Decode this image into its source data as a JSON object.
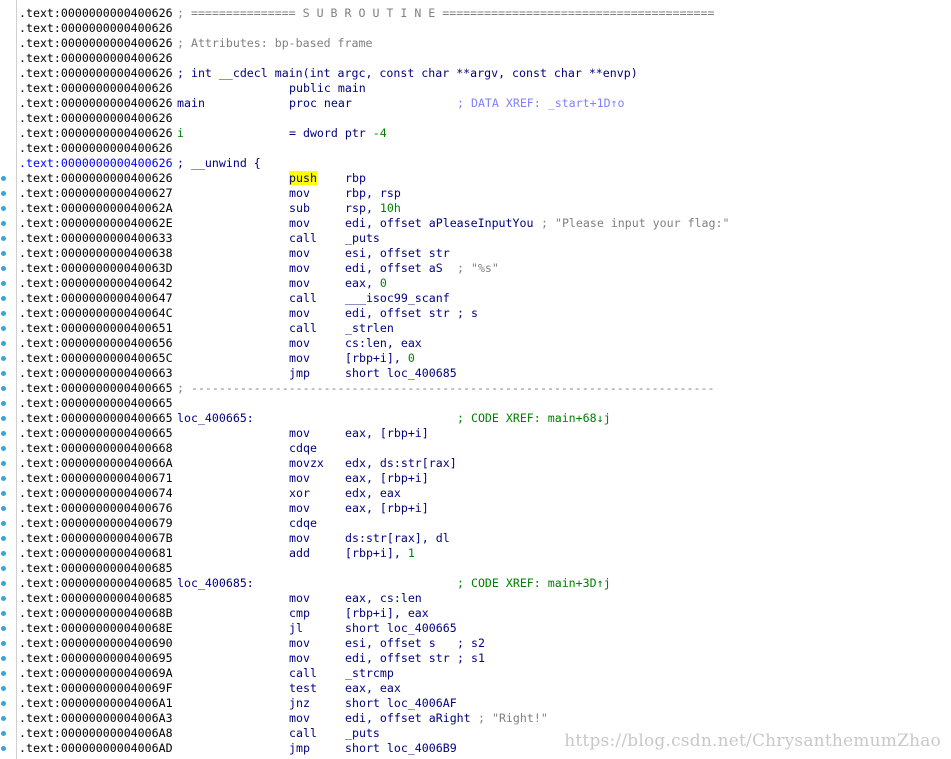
{
  "rows": [
    {
      "addr": ".text:0000000000400626",
      "c1": "; =============== S U B R O U T I N E =======================================",
      "c1cls": "cmt"
    },
    {
      "addr": ".text:0000000000400626"
    },
    {
      "addr": ".text:0000000000400626",
      "c1": "; Attributes: bp-based frame",
      "c1cls": "cmt"
    },
    {
      "addr": ".text:0000000000400626"
    },
    {
      "addr": ".text:0000000000400626",
      "c1": "; int __cdecl main(int argc, const char **argv, const char **envp)",
      "c1cls": "proto"
    },
    {
      "addr": ".text:0000000000400626",
      "c2": "public main"
    },
    {
      "addr": ".text:0000000000400626",
      "c1": "main",
      "c2": "proc near",
      "tail": "; DATA XREF: _start+1D↑o",
      "tailcls": "xrefd",
      "tailpos": 457
    },
    {
      "addr": ".text:0000000000400626"
    },
    {
      "addr": ".text:0000000000400626",
      "c1": "i",
      "c1cls": "var",
      "c2": "= dword ptr -4",
      "c2num": "-4"
    },
    {
      "addr": ".text:0000000000400626"
    },
    {
      "addr": ".text:0000000000400626",
      "c1": "; __unwind {",
      "c1cls": "proto",
      "cur": true
    },
    {
      "addr": ".text:0000000000400626",
      "dot": true,
      "c2": "push",
      "c2hl": true,
      "c3": "rbp"
    },
    {
      "addr": ".text:0000000000400627",
      "dot": true,
      "c2": "mov",
      "c3": "rbp, rsp"
    },
    {
      "addr": ".text:000000000040062A",
      "dot": true,
      "c2": "sub",
      "c3": "rsp, 10h",
      "c3num": "10h"
    },
    {
      "addr": ".text:000000000040062E",
      "dot": true,
      "c2": "mov",
      "c3": "edi, offset aPleaseInputYou",
      "tail": "; \"Please input your flag:\"",
      "tailcls": "cmt",
      "tailpos": 541
    },
    {
      "addr": ".text:0000000000400633",
      "dot": true,
      "c2": "call",
      "c3": "_puts"
    },
    {
      "addr": ".text:0000000000400638",
      "dot": true,
      "c2": "mov",
      "c3": "esi, offset str"
    },
    {
      "addr": ".text:000000000040063D",
      "dot": true,
      "c2": "mov",
      "c3": "edi, offset aS",
      "tail": "; \"%s\"",
      "tailcls": "cmt",
      "tailpos": 457
    },
    {
      "addr": ".text:0000000000400642",
      "dot": true,
      "c2": "mov",
      "c3": "eax, 0",
      "c3num": "0"
    },
    {
      "addr": ".text:0000000000400647",
      "dot": true,
      "c2": "call",
      "c3": "___isoc99_scanf"
    },
    {
      "addr": ".text:000000000040064C",
      "dot": true,
      "c2": "mov",
      "c3": "edi, offset str",
      "tail": "; s",
      "tailcls": "ins",
      "tailpos": 457
    },
    {
      "addr": ".text:0000000000400651",
      "dot": true,
      "c2": "call",
      "c3": "_strlen"
    },
    {
      "addr": ".text:0000000000400656",
      "dot": true,
      "c2": "mov",
      "c3": "cs:len, eax"
    },
    {
      "addr": ".text:000000000040065C",
      "dot": true,
      "c2": "mov",
      "c3": "[rbp+i], 0",
      "c3num": "0"
    },
    {
      "addr": ".text:0000000000400663",
      "dot": true,
      "c2": "jmp",
      "c3": "short loc_400685"
    },
    {
      "addr": ".text:0000000000400665",
      "dot": true,
      "c1": "; ---------------------------------------------------------------------------",
      "c1cls": "sep"
    },
    {
      "addr": ".text:0000000000400665",
      "dot": true
    },
    {
      "addr": ".text:0000000000400665",
      "dot": true,
      "c1": "loc_400665:",
      "tail": "; CODE XREF: main+68↓j",
      "tailcls": "xref",
      "tailpos": 457
    },
    {
      "addr": ".text:0000000000400665",
      "dot": true,
      "c2": "mov",
      "c3": "eax, [rbp+i]"
    },
    {
      "addr": ".text:0000000000400668",
      "dot": true,
      "c2": "cdqe"
    },
    {
      "addr": ".text:000000000040066A",
      "dot": true,
      "c2": "movzx",
      "c3": "edx, ds:str[rax]"
    },
    {
      "addr": ".text:0000000000400671",
      "dot": true,
      "c2": "mov",
      "c3": "eax, [rbp+i]"
    },
    {
      "addr": ".text:0000000000400674",
      "dot": true,
      "c2": "xor",
      "c3": "edx, eax"
    },
    {
      "addr": ".text:0000000000400676",
      "dot": true,
      "c2": "mov",
      "c3": "eax, [rbp+i]"
    },
    {
      "addr": ".text:0000000000400679",
      "dot": true,
      "c2": "cdqe"
    },
    {
      "addr": ".text:000000000040067B",
      "dot": true,
      "c2": "mov",
      "c3": "ds:str[rax], dl"
    },
    {
      "addr": ".text:0000000000400681",
      "dot": true,
      "c2": "add",
      "c3": "[rbp+i], 1",
      "c3num": "1"
    },
    {
      "addr": ".text:0000000000400685",
      "dot": true
    },
    {
      "addr": ".text:0000000000400685",
      "dot": true,
      "c1": "loc_400685:",
      "tail": "; CODE XREF: main+3D↑j",
      "tailcls": "xref",
      "tailpos": 457
    },
    {
      "addr": ".text:0000000000400685",
      "dot": true,
      "c2": "mov",
      "c3": "eax, cs:len"
    },
    {
      "addr": ".text:000000000040068B",
      "dot": true,
      "c2": "cmp",
      "c3": "[rbp+i], eax"
    },
    {
      "addr": ".text:000000000040068E",
      "dot": true,
      "c2": "jl",
      "c3": "short loc_400665"
    },
    {
      "addr": ".text:0000000000400690",
      "dot": true,
      "c2": "mov",
      "c3": "esi, offset s",
      "tail": "; s2",
      "tailcls": "ins",
      "tailpos": 457
    },
    {
      "addr": ".text:0000000000400695",
      "dot": true,
      "c2": "mov",
      "c3": "edi, offset str",
      "tail": "; s1",
      "tailcls": "ins",
      "tailpos": 457
    },
    {
      "addr": ".text:000000000040069A",
      "dot": true,
      "c2": "call",
      "c3": "_strcmp"
    },
    {
      "addr": ".text:000000000040069F",
      "dot": true,
      "c2": "test",
      "c3": "eax, eax"
    },
    {
      "addr": ".text:00000000004006A1",
      "dot": true,
      "c2": "jnz",
      "c3": "short loc_4006AF"
    },
    {
      "addr": ".text:00000000004006A3",
      "dot": true,
      "c2": "mov",
      "c3": "edi, offset aRight",
      "tail": "; \"Right!\"",
      "tailcls": "cmt",
      "tailpos": 478
    },
    {
      "addr": ".text:00000000004006A8",
      "dot": true,
      "c2": "call",
      "c3": "_puts"
    },
    {
      "addr": ".text:00000000004006AD",
      "dot": true,
      "c2": "jmp",
      "c3": "short loc_4006B9"
    }
  ],
  "watermark": "https://blog.csdn.net/ChrysanthemumZhao",
  "colors": {
    "background": "#ffffff",
    "text": "#000080",
    "comment": "#808080",
    "xref": "#008000",
    "data_xref": "#8080ff",
    "number": "#008000",
    "highlight": "#ffff00",
    "flow_dot": "#31a8dd"
  }
}
